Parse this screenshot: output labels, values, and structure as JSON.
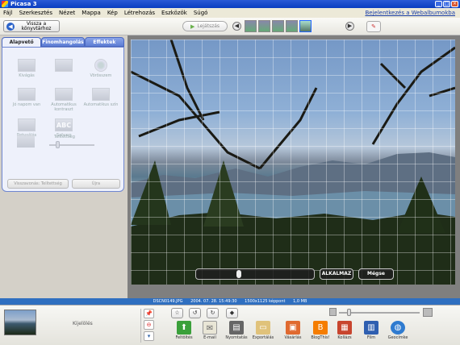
{
  "window": {
    "title": "Picasa 3"
  },
  "menu": {
    "items": [
      "Fájl",
      "Szerkesztés",
      "Nézet",
      "Mappa",
      "Kép",
      "Létrehozás",
      "Eszközök",
      "Súgó"
    ],
    "signin": "Bejelentkezés a Webalbumokba"
  },
  "toolbar": {
    "back_label": "Vissza a könyvtárhoz",
    "play_label": "Lejátszás"
  },
  "tabs": [
    "Alapvető javítások",
    "Finomhangolás",
    "Effektek"
  ],
  "tools": {
    "crop": "Kivágás",
    "redeye": "Vörösszem",
    "luck": "Jó napom van",
    "autocontrast": "Automatikus kontraszt",
    "autocolor": "Automatikus szín",
    "retouch": "Retusálás",
    "text": "Szöveg",
    "fill_light": "Telítettség"
  },
  "panel_buttons": {
    "undo": "Visszavonás: Telítettség",
    "redo": "Újra"
  },
  "overlay": {
    "apply": "ALKALMAZ",
    "cancel": "Mégse",
    "straighten_value": 0.35
  },
  "status": {
    "filename": "DSCN0149.JPG",
    "datetime": "2004. 07. 28. 15:49:30",
    "resolution": "1500x1125 képpont",
    "size": "1,0 MB"
  },
  "tray": {
    "label": "Kijelölés",
    "zoom_value": 0.1,
    "buttons": [
      "Feltöltés",
      "E-mail",
      "Nyomtatás",
      "Exportálás",
      "Vásárlás",
      "BlogThis!",
      "Kollázs",
      "Film",
      "Geocímke"
    ]
  },
  "colors": {
    "titlebar": "#0a3ec0",
    "status": "#2f6fc0",
    "tab_active_border": "#6f86d0"
  }
}
